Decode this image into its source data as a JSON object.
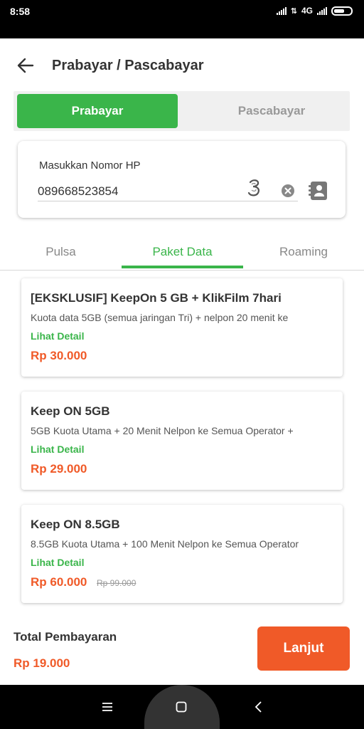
{
  "status_bar": {
    "time": "8:58",
    "network": "4G"
  },
  "header": {
    "title": "Prabayar / Pascabayar"
  },
  "toggle": {
    "prabayar": "Prabayar",
    "pascabayar": "Pascabayar"
  },
  "input": {
    "label": "Masukkan Nomor HP",
    "value": "089668523854"
  },
  "tabs": [
    {
      "label": "Pulsa"
    },
    {
      "label": "Paket Data"
    },
    {
      "label": "Roaming"
    }
  ],
  "packages": [
    {
      "title": "[EKSKLUSIF] KeepOn 5 GB + KlikFilm 7hari",
      "desc": "Kuota data 5GB (semua jaringan Tri) + nelpon 20 menit ke",
      "detail": "Lihat Detail",
      "price": "Rp 30.000"
    },
    {
      "title": "Keep ON 5GB",
      "desc": "5GB Kuota Utama + 20 Menit Nelpon ke Semua Operator +",
      "detail": "Lihat Detail",
      "price": "Rp 29.000"
    },
    {
      "title": "Keep ON 8.5GB",
      "desc": "8.5GB Kuota Utama + 100 Menit Nelpon ke Semua Operator",
      "detail": "Lihat Detail",
      "price": "Rp 60.000",
      "old_price": "Rp 99.000"
    }
  ],
  "footer": {
    "total_label": "Total Pembayaran",
    "total_value": "Rp 19.000",
    "button": "Lanjut"
  },
  "colors": {
    "green": "#3ab54a",
    "orange": "#f05a28"
  }
}
